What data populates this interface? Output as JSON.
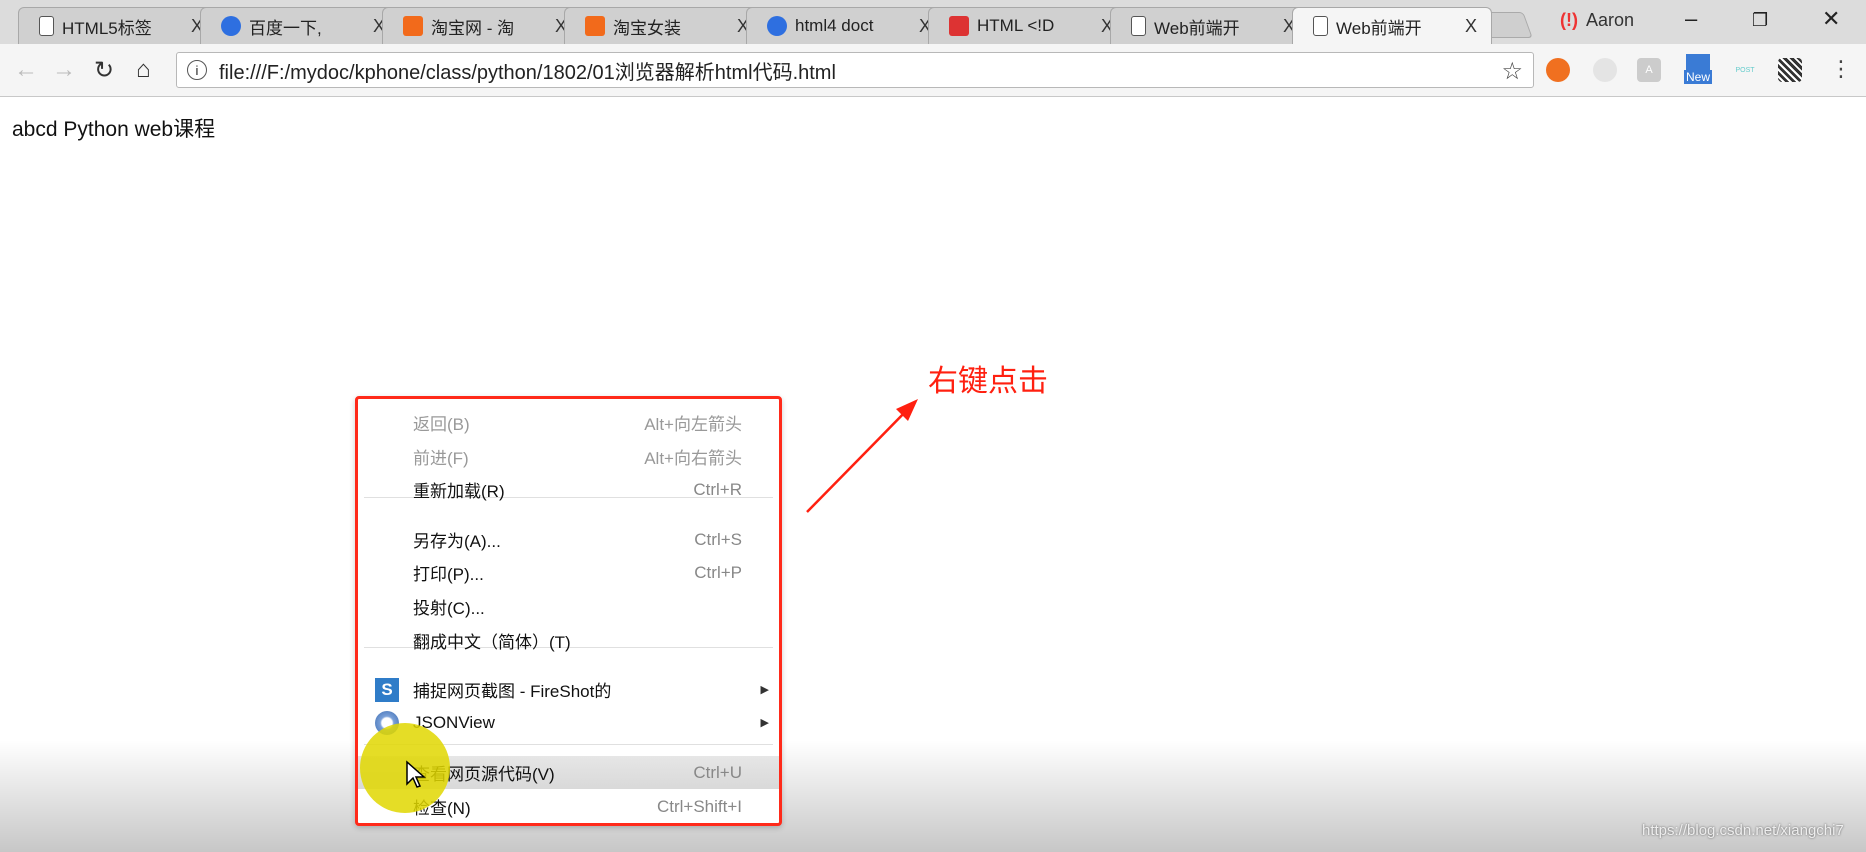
{
  "tabs": [
    {
      "title": "HTML5标签",
      "icon": "page-icon"
    },
    {
      "title": "百度一下,",
      "icon": "baidu-icon"
    },
    {
      "title": "淘宝网 - 淘",
      "icon": "taobao-icon"
    },
    {
      "title": "淘宝女装",
      "icon": "taobao-icon"
    },
    {
      "title": "html4 doct",
      "icon": "baidu-icon"
    },
    {
      "title": "HTML <!D",
      "icon": "w3school-icon"
    },
    {
      "title": "Web前端开",
      "icon": "page-icon"
    },
    {
      "title": "Web前端开",
      "icon": "page-icon",
      "active": true
    }
  ],
  "close_glyph": "X",
  "profile": {
    "name": "Aaron"
  },
  "address": {
    "url": "file:///F:/mydoc/kphone/class/python/1802/01浏览器解析html代码.html"
  },
  "extensions": {
    "new_badge": "New",
    "post_label": "POST"
  },
  "page": {
    "text": "abcd Python web课程"
  },
  "context_menu": {
    "items": [
      {
        "label": "返回(B)",
        "shortcut": "Alt+向左箭头",
        "disabled": true
      },
      {
        "label": "前进(F)",
        "shortcut": "Alt+向右箭头",
        "disabled": true
      },
      {
        "label": "重新加载(R)",
        "shortcut": "Ctrl+R"
      },
      {
        "label": "另存为(A)...",
        "shortcut": "Ctrl+S"
      },
      {
        "label": "打印(P)...",
        "shortcut": "Ctrl+P"
      },
      {
        "label": "投射(C)..."
      },
      {
        "label": "翻成中文（简体）(T)"
      },
      {
        "label": "捕捉网页截图 - FireShot的",
        "submenu": true
      },
      {
        "label": "JSONView",
        "submenu": true
      },
      {
        "label": "查看网页源代码(V)",
        "shortcut": "Ctrl+U",
        "highlighted": true
      },
      {
        "label": "检查(N)",
        "shortcut": "Ctrl+Shift+I"
      }
    ]
  },
  "annotation": {
    "text": "右键点击",
    "color": "#ff2010"
  },
  "watermark": "https://blog.csdn.net/xiangchi7"
}
